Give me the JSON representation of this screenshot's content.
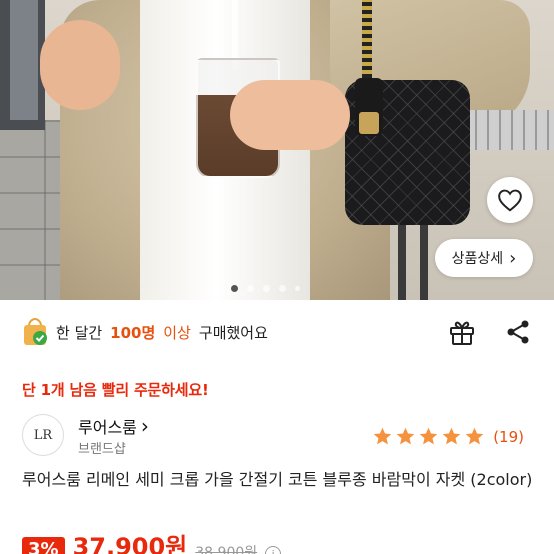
{
  "product_image": {
    "carousel": {
      "total_pages": 5,
      "active_index": 0
    }
  },
  "actions": {
    "wishlist_icon": "heart-outline-icon",
    "detail_label": "상품상세",
    "detail_chevron": "›"
  },
  "buyers": {
    "prefix": "한 달간",
    "count": "100명",
    "middle": "이상",
    "suffix": "구매했어요"
  },
  "urgent_notice": {
    "prefix": "단",
    "count": "1개",
    "suffix": "남음 빨리 주문하세요!"
  },
  "shop": {
    "logo_text": "LR",
    "name": "루어스룸",
    "chevron": "›",
    "type": "브랜드샵",
    "rating_stars": 5,
    "review_count": "(19)"
  },
  "product": {
    "title": "루어스룸 리메인 세미 크롭 가을 간절기 코튼 블루종 바람막이 자켓 (2color)"
  },
  "price": {
    "discount": "3%",
    "sale_price": "37,900원",
    "original_price": "38,900원",
    "info_icon": "i"
  },
  "colors": {
    "accent": "#e8500e",
    "sale_red": "#e8290c",
    "star": "#f5923e"
  }
}
